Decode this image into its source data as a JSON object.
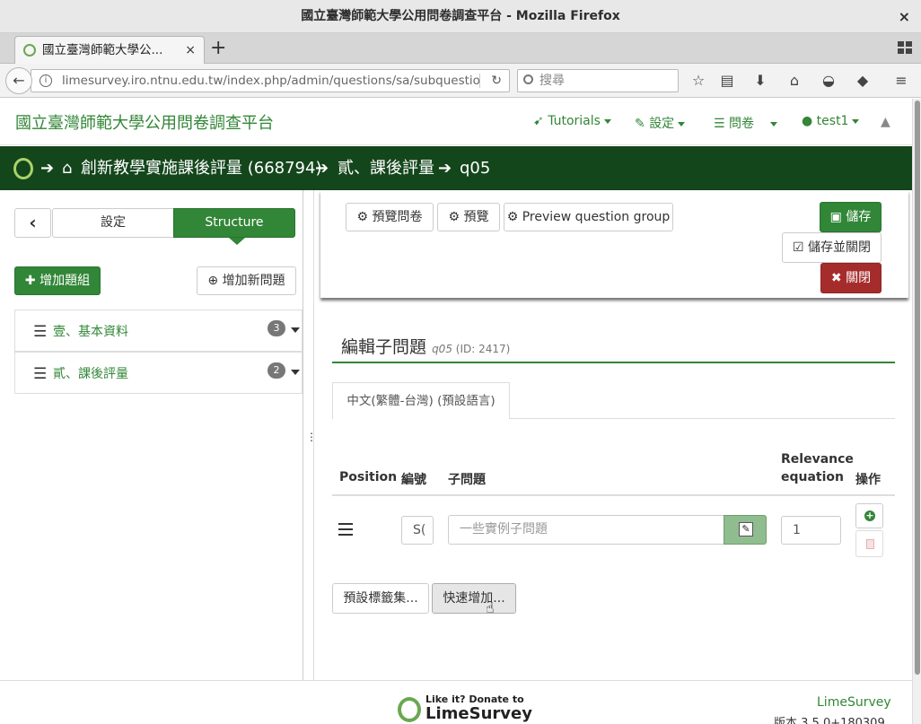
{
  "window": {
    "title": "國立臺灣師範大學公用問卷調查平台 - Mozilla Firefox",
    "close_glyph": "×"
  },
  "browser": {
    "tab_title": "國立臺灣師範大學公...",
    "tab_close_glyph": "×",
    "new_tab_glyph": "+",
    "url": "limesurvey.iro.ntnu.edu.tw/index.php/admin/questions/sa/subquestio",
    "search_placeholder": "搜尋",
    "info_glyph": "i",
    "reload_glyph": "↻",
    "back_glyph": "←",
    "icons": [
      "bookmark-star-icon",
      "reader-icon",
      "download-icon",
      "home-icon",
      "pocket-icon",
      "sync-icon",
      "menu-icon"
    ]
  },
  "ls": {
    "brand": "國立臺灣師範大學公用問卷調查平台",
    "menu": {
      "tutorials": "Tutorials",
      "settings": "設定",
      "surveys": "問卷",
      "user": "test1"
    },
    "breadcrumb": {
      "survey": "創新教學實施課後評量 (668794)",
      "group": "貳、課後評量",
      "question": "q05"
    }
  },
  "sidebar": {
    "back_glyph": "‹",
    "tab_settings": "設定",
    "tab_structure": "Structure",
    "add_group": "增加題組",
    "add_question": "增加新問題",
    "groups": [
      {
        "name": "壹、基本資料",
        "count": "3"
      },
      {
        "name": "貳、課後評量",
        "count": "2"
      }
    ],
    "grip": "⋮"
  },
  "toolbar": {
    "preview_survey": "預覽問卷",
    "preview": "預覽",
    "preview_group": "Preview question group",
    "save": "儲存",
    "save_close": "儲存並關閉",
    "close": "關閉"
  },
  "editor": {
    "title": "編輯子問題",
    "code": "q05",
    "id": "(ID: 2417)",
    "language_tab": "中文(繁體-台灣) (預設語言)",
    "columns": {
      "position": "Position",
      "code": "編號",
      "subquestion": "子問題",
      "relevance_1": "Relevance",
      "relevance_2": "equation",
      "actions": "操作"
    },
    "row": {
      "code_value": "S(",
      "subquestion_placeholder": "一些實例子問題",
      "relevance_value": "1"
    },
    "buttons": {
      "label_sets": "預設標籤集...",
      "quick_add": "快速增加..."
    }
  },
  "footer": {
    "donate_line1": "Like it? Donate to",
    "donate_line2": "LimeSurvey",
    "brand": "LimeSurvey",
    "version": "版本 3.5.0+180309"
  },
  "colors": {
    "brand_green": "#328637",
    "header_dark_green": "#14461c",
    "close_red": "#a62c2c"
  }
}
